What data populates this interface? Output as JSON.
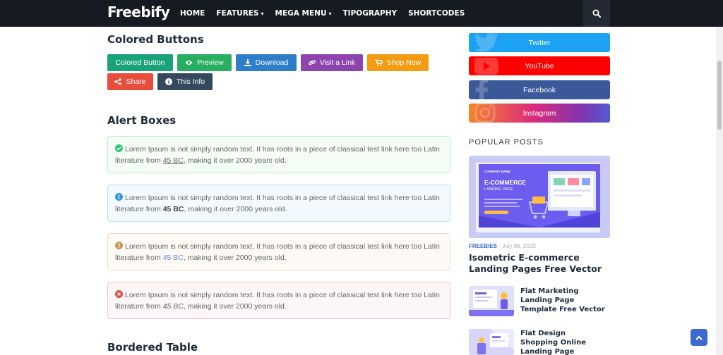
{
  "nav": {
    "logo": "Freebify",
    "items": [
      {
        "label": "HOME",
        "dropdown": false
      },
      {
        "label": "FEATURES",
        "dropdown": true
      },
      {
        "label": "MEGA MENU",
        "dropdown": true
      },
      {
        "label": "TIPOGRAPHY",
        "dropdown": false
      },
      {
        "label": "SHORTCODES",
        "dropdown": false
      }
    ],
    "search_icon": "search-icon"
  },
  "colored_buttons": {
    "heading": "Colored Buttons",
    "buttons": [
      {
        "label": "Colored Button",
        "color": "#1aa37a",
        "icon": ""
      },
      {
        "label": "Preview",
        "color": "#27ae60",
        "icon": "eye-icon"
      },
      {
        "label": "Download",
        "color": "#2d7dc9",
        "icon": "download-icon"
      },
      {
        "label": "Visit a Link",
        "color": "#8e44ad",
        "icon": "link-icon"
      },
      {
        "label": "Shop Now",
        "color": "#f39c12",
        "icon": "cart-icon"
      },
      {
        "label": "Share",
        "color": "#e74c3c",
        "icon": "share-icon"
      },
      {
        "label": "This Info",
        "color": "#34495e",
        "icon": "info-icon"
      }
    ]
  },
  "alert_boxes": {
    "heading": "Alert Boxes",
    "alerts": [
      {
        "type": "success",
        "text": "Lorem Ipsum is not simply random text. It has roots in a piece of classical test link here too Latin literature from ",
        "highlight": "45 BC",
        "tail": ", making it over 2000 years old.",
        "color": "#2ecc71"
      },
      {
        "type": "info",
        "text": "Lorem Ipsum is not simply random text. It has roots in a piece of classical test link here too Latin literature from ",
        "highlight": "45 BC",
        "tail": ", making it over 2000 years old.",
        "color": "#3498db"
      },
      {
        "type": "warning",
        "text": "Lorem Ipsum is not simply random text. It has roots in a piece of classical test link here too Latin literature from ",
        "highlight": "45 BC",
        "tail": ", making it over 2000 years old.",
        "color": "#c79a5b"
      },
      {
        "type": "error",
        "text": "Lorem Ipsum is not simply random text. It has roots in a piece of classical test link here too Latin literature from ",
        "highlight": "45 BC",
        "tail": ", making it over 2000 years old.",
        "color": "#e74c3c"
      }
    ]
  },
  "bordered_table": {
    "heading": "Bordered Table"
  },
  "sidebar": {
    "social": [
      {
        "label": "Twitter",
        "color": "#1da1f2"
      },
      {
        "label": "YouTube",
        "color": "#ff0000"
      },
      {
        "label": "Facebook",
        "color": "#3b5998"
      },
      {
        "label": "Instagram",
        "color": "#c13584"
      }
    ],
    "popular_heading": "POPULAR POSTS",
    "featured": {
      "category": "FREEBIES",
      "date": "July 06, 2020",
      "title": "Isometric E-commerce Landing Pages Free Vector",
      "image_text": {
        "company": "COMPANY NAME",
        "headline": "E-COMMERCE",
        "subline": "LANDING PAGE"
      }
    },
    "posts": [
      {
        "title": "Flat Marketing Landing Page Template Free Vector"
      },
      {
        "title": "Flat Design Shopping Online Landing Page Template"
      }
    ]
  },
  "back_to_top_icon": "chevron-up-icon"
}
